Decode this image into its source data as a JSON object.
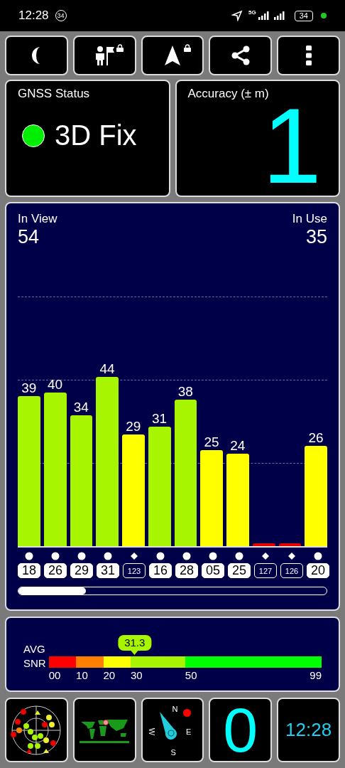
{
  "status_bar": {
    "time": "12:28",
    "notification_badge": "34",
    "network": "5G",
    "battery": "34"
  },
  "toolbar": [
    {
      "kind": "moon",
      "locked": false
    },
    {
      "kind": "person-flag",
      "locked": true
    },
    {
      "kind": "arrow",
      "locked": true
    },
    {
      "kind": "share",
      "locked": false
    },
    {
      "kind": "more",
      "locked": false
    }
  ],
  "gnss_status": {
    "title": "GNSS Status",
    "value": "3D Fix",
    "color": "#00ee00"
  },
  "accuracy": {
    "title": "Accuracy (± m)",
    "value": "1"
  },
  "signal_panel": {
    "in_view_label": "In View",
    "in_view": "54",
    "in_use_label": "In Use",
    "in_use": "35",
    "satellites": [
      {
        "id": "18",
        "snr": "39",
        "color": "#a8f500",
        "kind": "circle",
        "used": true
      },
      {
        "id": "26",
        "snr": "40",
        "color": "#a8f500",
        "kind": "circle",
        "used": true
      },
      {
        "id": "29",
        "snr": "34",
        "color": "#a8f500",
        "kind": "circle",
        "used": true
      },
      {
        "id": "31",
        "snr": "44",
        "color": "#a8f500",
        "kind": "circle",
        "used": true
      },
      {
        "id": "123",
        "snr": "29",
        "color": "#ffff00",
        "kind": "diamond",
        "used": false
      },
      {
        "id": "16",
        "snr": "31",
        "color": "#a8f500",
        "kind": "circle",
        "used": true
      },
      {
        "id": "28",
        "snr": "38",
        "color": "#a8f500",
        "kind": "circle",
        "used": true
      },
      {
        "id": "05",
        "snr": "25",
        "color": "#ffff00",
        "kind": "circle",
        "used": true
      },
      {
        "id": "25",
        "snr": "24",
        "color": "#ffff00",
        "kind": "circle",
        "used": true
      },
      {
        "id": "127",
        "color": "#e00000",
        "kind": "diamond",
        "used": false
      },
      {
        "id": "126",
        "color": "#e00000",
        "kind": "diamond",
        "used": false
      },
      {
        "id": "20",
        "snr": "26",
        "color": "#ffff00",
        "kind": "circle",
        "used": true
      }
    ]
  },
  "snr_panel": {
    "label_top": "AVG",
    "label_bottom": "SNR",
    "average": "31.3",
    "segments": [
      {
        "color": "#ff0000"
      },
      {
        "color": "#ff8000"
      },
      {
        "color": "#ffff00"
      },
      {
        "color": "#a8f500"
      },
      {
        "color": "#00ff00"
      }
    ],
    "ticks": [
      "00",
      "10",
      "20",
      "30",
      "50",
      "99"
    ]
  },
  "bottom_tiles": {
    "compass": {
      "north": "N",
      "east": "E",
      "south": "S",
      "west": "W"
    },
    "speed": "0",
    "clock": "12:28"
  }
}
